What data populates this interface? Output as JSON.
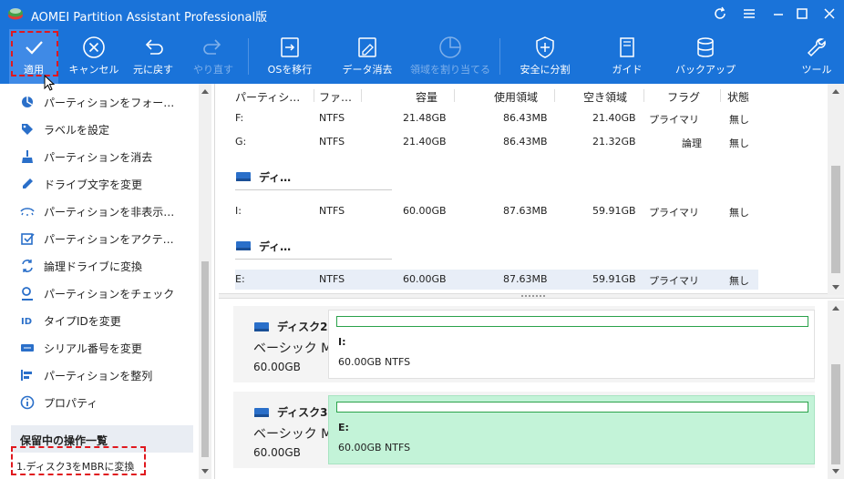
{
  "app": {
    "title": "AOMEI Partition Assistant Professional版"
  },
  "toolbar": {
    "buttons": [
      {
        "label": "適用",
        "icon": "check-circle-icon"
      },
      {
        "label": "キャンセル",
        "icon": "x-circle-icon"
      },
      {
        "label": "元に戻す",
        "icon": "undo-icon"
      },
      {
        "label": "やり直す",
        "icon": "redo-icon"
      },
      {
        "label": "OSを移行",
        "icon": "migrate-os-icon"
      },
      {
        "label": "データ消去",
        "icon": "wipe-disk-icon"
      },
      {
        "label": "領域を割り当てる",
        "icon": "pie-allocate-icon"
      },
      {
        "label": "安全に分割",
        "icon": "shield-plus-icon"
      },
      {
        "label": "ガイド",
        "icon": "book-icon"
      },
      {
        "label": "バックアップ",
        "icon": "database-backup-icon"
      },
      {
        "label": "ツール",
        "icon": "wrench-icon"
      }
    ]
  },
  "operations": {
    "items": [
      {
        "label": "パーティションをフォー…",
        "icon": "format-icon"
      },
      {
        "label": "ラベルを設定",
        "icon": "tag-icon"
      },
      {
        "label": "パーティションを消去",
        "icon": "broom-icon"
      },
      {
        "label": "ドライブ文字を変更",
        "icon": "pencil-icon"
      },
      {
        "label": "パーティションを非表示…",
        "icon": "eye-hide-icon"
      },
      {
        "label": "パーティションをアクテ…",
        "icon": "check-square-icon"
      },
      {
        "label": "論理ドライブに変換",
        "icon": "convert-icon"
      },
      {
        "label": "パーティションをチェック",
        "icon": "magnifier-icon"
      },
      {
        "label": "タイプIDを変更",
        "icon": "id-icon"
      },
      {
        "label": "シリアル番号を変更",
        "icon": "serial-icon"
      },
      {
        "label": "パーティションを整列",
        "icon": "align-icon"
      },
      {
        "label": "プロパティ",
        "icon": "info-icon"
      }
    ]
  },
  "pending": {
    "header": "保留中の操作一覧",
    "items": [
      "1.ディスク3をMBRに変換"
    ]
  },
  "table": {
    "headers": [
      "パーティシ…",
      "ファ…",
      "容量",
      "使用領域",
      "空き領域",
      "フラグ",
      "状態"
    ],
    "rows_top": [
      {
        "partition": "F:",
        "fs": "NTFS",
        "capacity": "21.48GB",
        "used": "86.43MB",
        "free": "21.40GB",
        "flag": "プライマリ",
        "status": "無し"
      },
      {
        "partition": "G:",
        "fs": "NTFS",
        "capacity": "21.40GB",
        "used": "86.43MB",
        "free": "21.32GB",
        "flag": "論理",
        "status": "無し"
      }
    ],
    "disk2_label": "ディ…",
    "rows_disk2": [
      {
        "partition": "I:",
        "fs": "NTFS",
        "capacity": "60.00GB",
        "used": "87.63MB",
        "free": "59.91GB",
        "flag": "プライマリ",
        "status": "無し"
      }
    ],
    "disk3_label": "ディ…",
    "rows_disk3": [
      {
        "partition": "E:",
        "fs": "NTFS",
        "capacity": "60.00GB",
        "used": "87.63MB",
        "free": "59.91GB",
        "flag": "プライマリ",
        "status": "無し"
      }
    ]
  },
  "disk_cards": [
    {
      "name": "ディスク2",
      "type": "ベーシック M",
      "size": "60.00GB",
      "part_letter": "I:",
      "part_info": "60.00GB NTFS",
      "selected": false
    },
    {
      "name": "ディスク3",
      "type": "ベーシック M",
      "size": "60.00GB",
      "part_letter": "E:",
      "part_info": "60.00GB NTFS",
      "selected": true
    }
  ],
  "colors": {
    "titlebar": "#1a73d9",
    "selected_partition": "#c3f3d8",
    "partition_border": "#2aa24a",
    "highlight_dash": "#e0181e"
  }
}
